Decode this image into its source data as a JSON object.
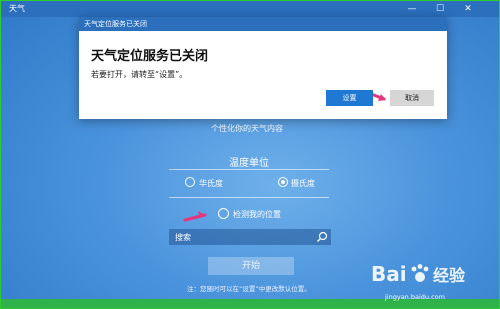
{
  "window": {
    "app_title": "天气",
    "minimize": "—",
    "maximize": "☐",
    "close": "✕"
  },
  "dialog": {
    "title": "天气定位服务已关闭",
    "heading": "天气定位服务已关闭",
    "message": "若要打开，请转至“设置”。",
    "settings_button": "设置",
    "cancel_button": "取消"
  },
  "panel": {
    "personalize_text": "个性化你的天气内容",
    "temperature_unit_title": "温度单位",
    "fahrenheit_label": "华氏度",
    "celsius_label": "摄氏度",
    "selected_unit": "celsius",
    "detect_location_label": "检测我的位置",
    "search_placeholder": "搜索",
    "start_button": "开始",
    "note": "注：您随时可以在“设置”中更改默认位置。"
  },
  "colors": {
    "accent": "#1f78d1",
    "titlebar": "#2b6fbd",
    "arrow": "#e8347a",
    "frame_border": "#2ecc2e"
  },
  "watermark": {
    "url": "jingyan.baidu.com"
  }
}
